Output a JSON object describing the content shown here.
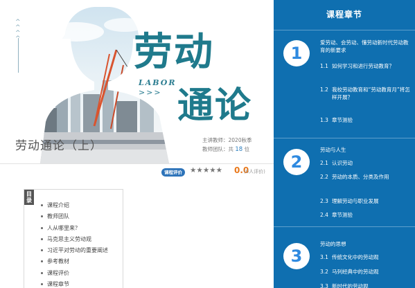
{
  "banner": {
    "title_line1": "劳动",
    "title_line2": "通论",
    "labor_text": "LABOR",
    "labor_arrows": ">>>",
    "chevrons": "^^^^"
  },
  "course": {
    "title": "劳动通论（上）",
    "teacher_line": "主讲教师：2020秋季",
    "team_prefix": "教师团队：共",
    "team_count": "18",
    "team_suffix": "位"
  },
  "rating": {
    "badge": "课程评价",
    "stars": "★★★★★",
    "score": "0.0",
    "count": "(0人评价)"
  },
  "toc": {
    "tag": "目录",
    "items": [
      "课程介绍",
      "教师团队",
      "人从哪里来？",
      "马克思主义劳动观",
      "习近平对劳动的重要阐述",
      "参考教材",
      "课程评价",
      "课程章节"
    ]
  },
  "sidebar": {
    "heading": "课程章节",
    "chapters": [
      {
        "number": "1",
        "title": "爱劳动、会劳动、懂劳动新时代劳动教育的新要求",
        "sections": [
          {
            "num": "1.1",
            "text": "如何学习和进行劳动教育？"
          },
          {
            "num": "1.2",
            "text": "我校劳动教育和“劳动教育月”将怎样开展？"
          },
          {
            "num": "1.3",
            "text": "章节测验"
          }
        ]
      },
      {
        "number": "2",
        "title": "劳动与人生",
        "sections": [
          {
            "num": "2.1",
            "text": "认识劳动"
          },
          {
            "num": "2.2",
            "text": "劳动的本质、分类及作用"
          },
          {
            "num": "2.3",
            "text": "理解劳动与职业发展"
          },
          {
            "num": "2.4",
            "text": "章节测验"
          }
        ]
      },
      {
        "number": "3",
        "title": "劳动的思想",
        "sections": [
          {
            "num": "3.1",
            "text": "传统文化中的劳动观"
          },
          {
            "num": "3.2",
            "text": "马列经典中的劳动观"
          },
          {
            "num": "3.3",
            "text": "新时代的劳动观"
          }
        ]
      }
    ]
  },
  "colors": {
    "sidebar_bg": "#0f6fb0",
    "accent": "#2d73b9",
    "title_teal": "#1f7a8c",
    "score_orange": "#e9791c"
  }
}
